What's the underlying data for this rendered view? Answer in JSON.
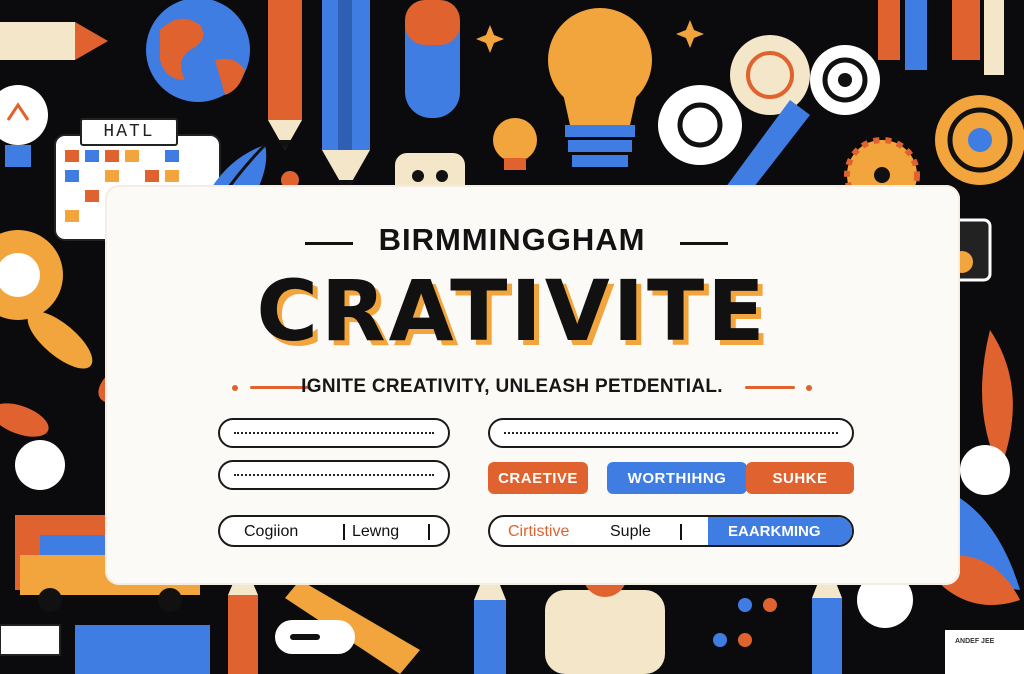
{
  "brand": "BIRMMINGGHAM",
  "headline": "CRATIVITE",
  "tagline": "IGNITE CREATIVITY, UNLEASH PETDENTIAL.",
  "calendar_label": "HATL",
  "buttons": [
    {
      "label": "CRAETIVE",
      "color": "#e0622e"
    },
    {
      "label": "WORTHIHNG",
      "color": "#3f7de3"
    },
    {
      "label": "SUHKE",
      "color": "#e0622e"
    }
  ],
  "left_segment": {
    "items": [
      "Cogiion",
      "Lewng"
    ]
  },
  "right_segment": {
    "items": [
      "Cirtistive",
      "Suple"
    ],
    "active": "EAARKMING",
    "active_color": "#3f7de3",
    "first_color": "#e0622e"
  },
  "corner_label": "ANDEF JEE",
  "palette": {
    "orange": "#e0622e",
    "blue": "#3f7de3",
    "yellow": "#f2a53c",
    "cream": "#f4e6c8",
    "dark": "#0b0b0d"
  }
}
